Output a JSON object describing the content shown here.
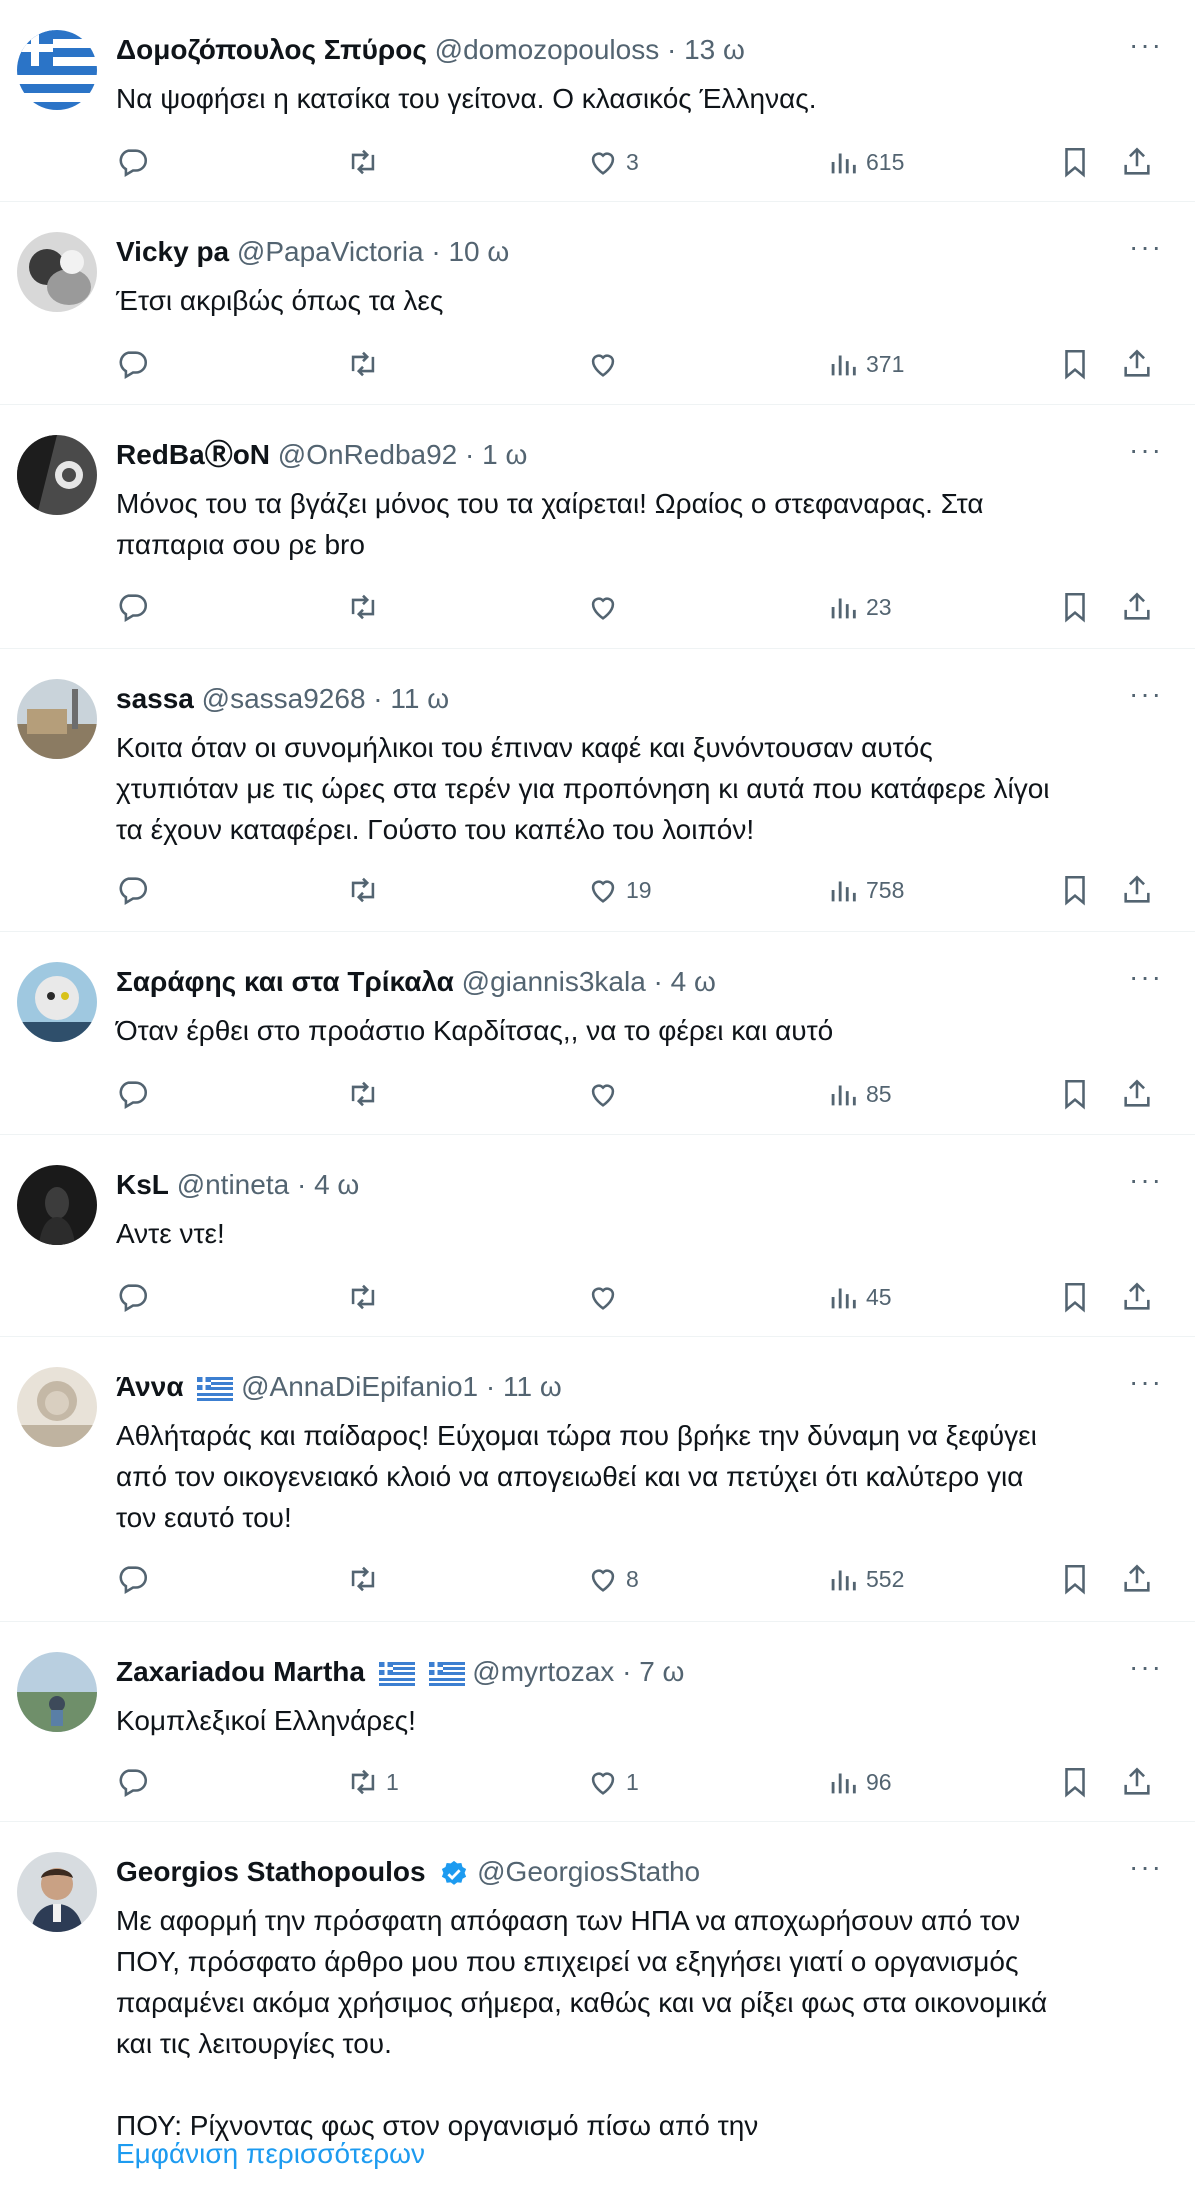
{
  "colors": {
    "text": "#0f1419",
    "muted": "#536471",
    "link": "#1d9bf0",
    "divider": "#eff3f4",
    "verified": "#1d9bf0"
  },
  "icons": [
    "reply-icon",
    "retweet-icon",
    "heart-icon",
    "views-icon",
    "bookmark-icon",
    "share-icon",
    "more-icon",
    "verified-badge-icon",
    "greek-flag-icon"
  ],
  "tweets": [
    {
      "name": "Δομοζόπουλος Σπύρος",
      "handle": "@domozopouloss",
      "time": "13 ω",
      "text": "Να ψοφήσει η κατσίκα του γείτονα. Ο κλασικός Έλληνας.",
      "replies": "",
      "retweets": "",
      "likes": "3",
      "views": "615"
    },
    {
      "name": "Vicky pa",
      "handle": "@PapaVictoria",
      "time": "10 ω",
      "text": "Έτσι ακριβώς όπως τα λες",
      "replies": "",
      "retweets": "",
      "likes": "",
      "views": "371"
    },
    {
      "name": "RedBaⓇoN",
      "handle": "@OnRedba92",
      "time": "1 ω",
      "text": "Μόνος του τα βγάζει μόνος του τα χαίρεται! Ωραίος ο στεφαναρας. Στα\nπαπαρια σου ρε bro",
      "replies": "",
      "retweets": "",
      "likes": "",
      "views": "23"
    },
    {
      "name": "sassa",
      "handle": "@sassa9268",
      "time": "11 ω",
      "text": "Κοιτα όταν οι συνομήλικοι του έπιναν καφέ και ξυνόντουσαν αυτός\nχτυπιόταν με τις ώρες στα τερέν για προπόνηση κι αυτά που κατάφερε λίγοι\nτα έχουν καταφέρει. Γούστο του καπέλο του λοιπόν!",
      "replies": "",
      "retweets": "",
      "likes": "19",
      "views": "758"
    },
    {
      "name": "Σαράφης και στα Τρίκαλα",
      "handle": "@giannis3kala",
      "time": "4 ω",
      "text": "Όταν έρθει στο προάστιο Καρδίτσας,, να το φέρει και αυτό",
      "replies": "",
      "retweets": "",
      "likes": "",
      "views": "85"
    },
    {
      "name": "KsL",
      "handle": "@ntineta",
      "time": "4 ω",
      "text": "Αντε ντε!",
      "replies": "",
      "retweets": "",
      "likes": "",
      "views": "45"
    },
    {
      "name": "Άννα",
      "handle": "@AnnaDiEpifanio1",
      "time": "11 ω",
      "text": "Αθλήταράς και παίδαρος! Εύχομαι τώρα που βρήκε την δύναμη να ξεφύγει\nαπό τον οικογενειακό κλοιό να απογειωθεί και να πετύχει ότι καλύτερο για\nτον εαυτό του!",
      "replies": "",
      "retweets": "",
      "likes": "8",
      "views": "552"
    },
    {
      "name": "Zaxariadou Martha",
      "handle": "@myrtozax",
      "time": "7 ω",
      "text": "Κομπλεξικοί Ελληνάρες!",
      "replies": "",
      "retweets": "1",
      "likes": "1",
      "views": "96"
    },
    {
      "name": "Georgios Stathopoulos",
      "handle": "@GeorgiosStatho",
      "time": "",
      "text": "Με αφορμή την πρόσφατη απόφαση των ΗΠΑ να αποχωρήσουν από τον\nΠΟΥ, πρόσφατο άρθρο μου που επιχειρεί να εξηγήσει γιατί ο οργανισμός\nπαραμένει ακόμα χρήσιμος σήμερα, καθώς και να ρίξει φως στα οικονομικά\nκαι τις λειτουργίες του.\n\nΠΟΥ: Ρίχνοντας φως στον οργανισμό πίσω από την",
      "show_more": "Εμφάνιση περισσότερων"
    }
  ],
  "separator_dot": "·",
  "more_label": "···"
}
